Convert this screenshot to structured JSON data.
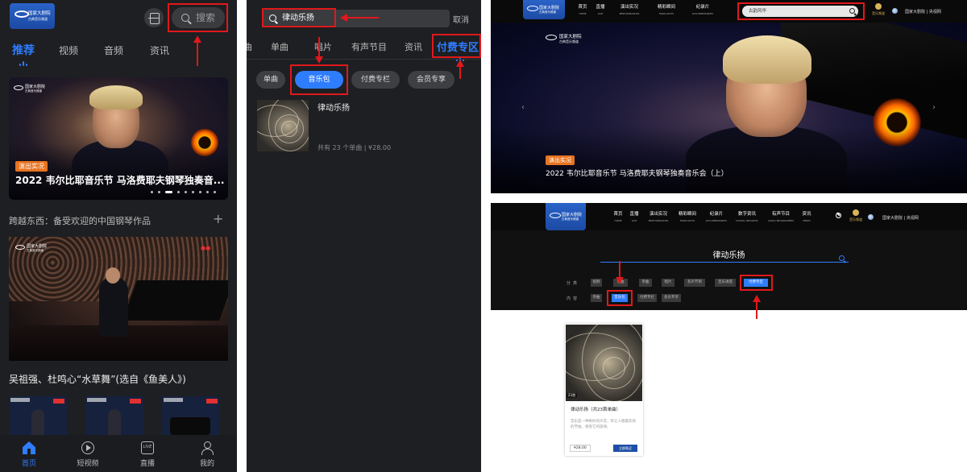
{
  "brand": {
    "logo_cn": "国家大剧院",
    "logo_sub": "古典音乐频道"
  },
  "mobile_home": {
    "search_placeholder": "搜索",
    "tabs": [
      {
        "label": "推荐",
        "active": true
      },
      {
        "label": "视频",
        "active": false
      },
      {
        "label": "音频",
        "active": false
      },
      {
        "label": "资讯",
        "active": false
      }
    ],
    "hero": {
      "tag": "演出实况",
      "title": "2022 韦尔比耶音乐节 马洛费耶夫钢琴独奏音..."
    },
    "section_title": "跨越东西：备受欢迎的中国钢琴作品",
    "section_action": "+",
    "video_title": "吴祖强、杜鸣心“水草舞”(选自《鱼美人》)",
    "bottom_nav": [
      {
        "label": "首页",
        "icon": "home-icon",
        "active": true
      },
      {
        "label": "短视频",
        "icon": "play-circle-icon",
        "active": false
      },
      {
        "label": "直播",
        "icon": "live-icon",
        "active": false
      },
      {
        "label": "我的",
        "icon": "user-icon",
        "active": false
      }
    ]
  },
  "mobile_search": {
    "query": "律动乐扬",
    "cancel": "取消",
    "tabs": [
      {
        "label": "单曲",
        "active": false
      },
      {
        "label": "唱片",
        "active": false
      },
      {
        "label": "有声节目",
        "active": false
      },
      {
        "label": "资讯",
        "active": false
      },
      {
        "label": "付费专区",
        "active": true
      }
    ],
    "chips": [
      {
        "label": "单曲",
        "active": false
      },
      {
        "label": "音乐包",
        "active": true
      },
      {
        "label": "付费专栏",
        "active": false
      },
      {
        "label": "会员专享",
        "active": false
      }
    ],
    "result": {
      "title": "律动乐扬",
      "meta": "共有 23 个单曲 | ¥28.00"
    }
  },
  "web_home": {
    "nav": [
      {
        "zh": "首页",
        "en": "HOME",
        "active": true
      },
      {
        "zh": "直播",
        "en": "LIVE",
        "active": false
      },
      {
        "zh": "演出实况",
        "en": "PERFORMANCES",
        "active": false
      },
      {
        "zh": "精彩瞬间",
        "en": "HIGHLIGHTS",
        "active": false
      },
      {
        "zh": "纪录片",
        "en": "DOCUMENTARIES",
        "active": false
      }
    ],
    "search_value": "古韵风华",
    "badge": "音乐频道",
    "links": "国家大剧院 | 央视网",
    "banner": {
      "tag": "演出实况",
      "title": "2022 韦尔比耶音乐节 马洛费耶夫钢琴独奏音乐会（上）"
    }
  },
  "web_search": {
    "nav": [
      {
        "zh": "首页",
        "en": "HOME"
      },
      {
        "zh": "直播",
        "en": "LIVE"
      },
      {
        "zh": "演出实况",
        "en": "PERFORMANCES"
      },
      {
        "zh": "精彩瞬间",
        "en": "HIGHLIGHTS"
      },
      {
        "zh": "纪录片",
        "en": "DOCUMENTARIES"
      },
      {
        "zh": "数字资讯",
        "en": "DIGITAL RECORDS"
      },
      {
        "zh": "有声节目",
        "en": "AUDIO PROGRAMMES"
      },
      {
        "zh": "资讯",
        "en": "NEWS"
      }
    ],
    "keyword": "律动乐扬",
    "filter_label_1": "分类",
    "filter_label_2": "内容",
    "category_chips": [
      {
        "label": "视频",
        "active": false
      },
      {
        "label": "单曲",
        "active": false
      },
      {
        "label": "单曲",
        "active": false
      },
      {
        "label": "唱片",
        "active": false
      },
      {
        "label": "有声节目",
        "active": false
      },
      {
        "label": "音乐讲座",
        "active": false
      },
      {
        "label": "付费专区",
        "active": true
      }
    ],
    "content_chips": [
      {
        "label": "单曲",
        "active": false
      },
      {
        "label": "音乐包",
        "active": true
      },
      {
        "label": "付费专栏",
        "active": false
      },
      {
        "label": "会员专享",
        "active": false
      }
    ],
    "card": {
      "count": "23首",
      "title": "律动乐扬（共23首单曲）",
      "desc": "音乐是一种奇妙的声音，聆让人随着欢快的节拍，感受它的旋律。",
      "price": "¥28.00",
      "buy": "立即购买"
    }
  }
}
